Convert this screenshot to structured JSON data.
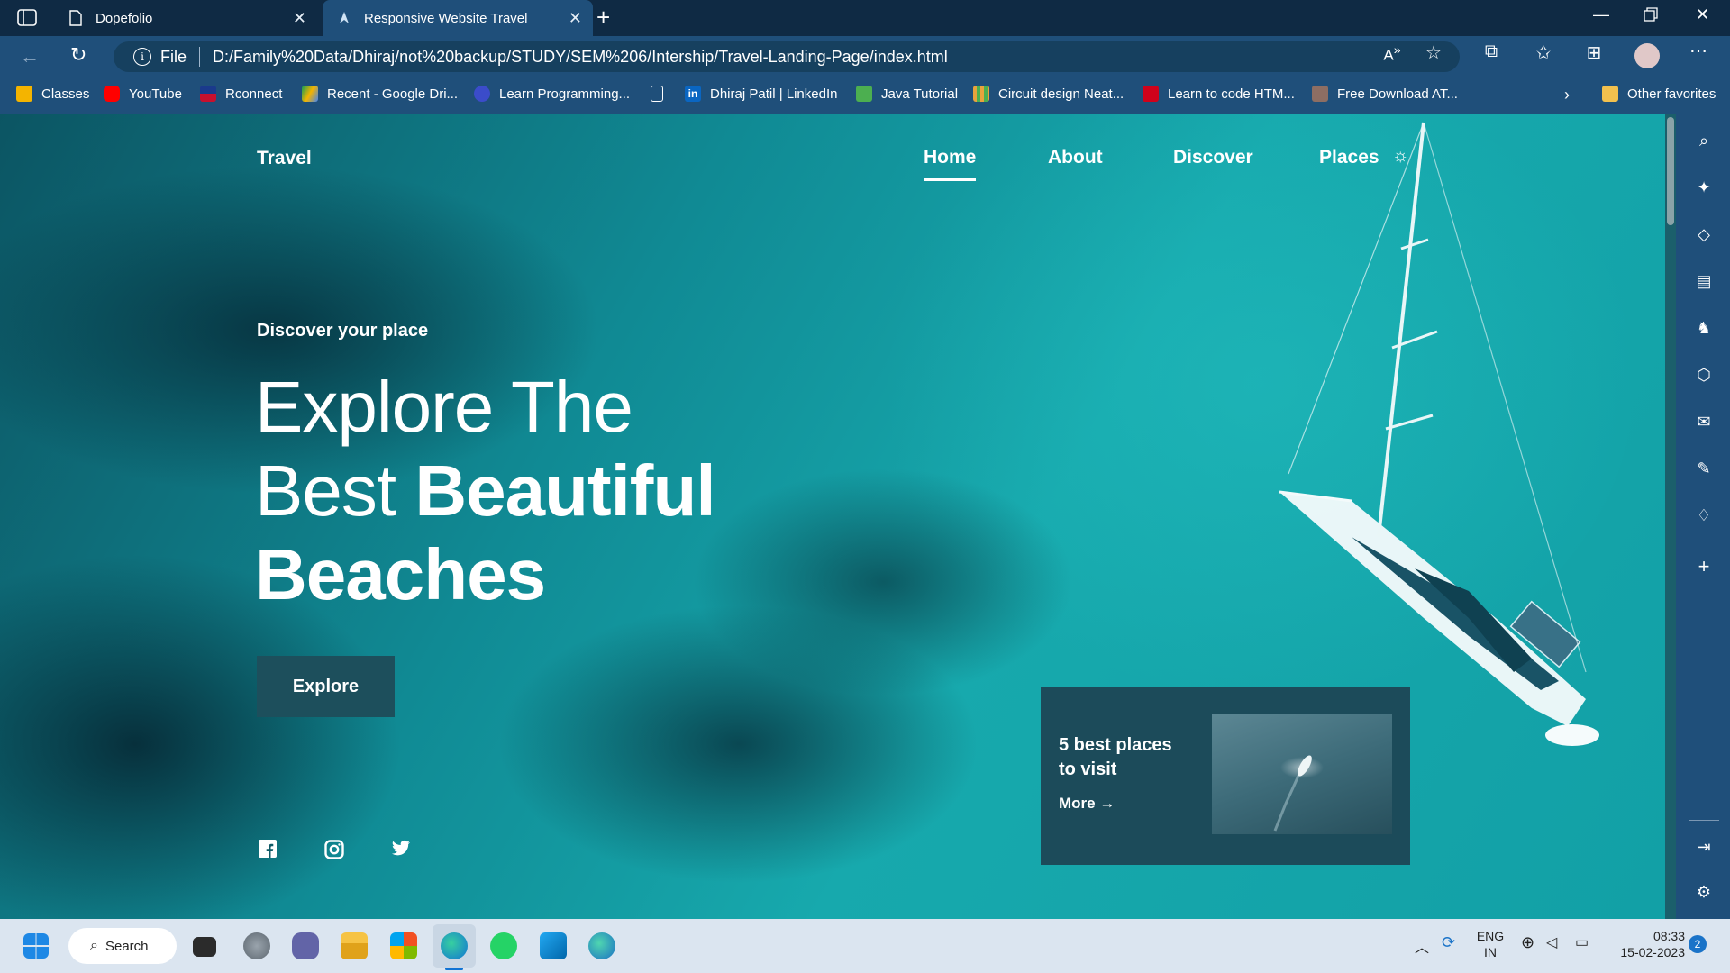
{
  "browser": {
    "tabs": [
      {
        "label": "Dopefolio",
        "icon": "page-icon"
      },
      {
        "label": "Responsive Website Travel",
        "icon": "site-icon"
      }
    ],
    "address": {
      "prefix": "File",
      "url": "D:/Family%20Data/Dhiraj/not%20backup/STUDY/SEM%206/Intership/Travel-Landing-Page/index.html"
    },
    "favorites": [
      {
        "label": "Classes",
        "color": "#f4b400"
      },
      {
        "label": "YouTube",
        "color": "#ff0000"
      },
      {
        "label": "Rconnect",
        "color": "#c8102e"
      },
      {
        "label": "Recent - Google Dri...",
        "color": "#0f9d58"
      },
      {
        "label": "Learn Programming...",
        "color": "#3b4cca"
      },
      {
        "label": "",
        "color": "#ffffff"
      },
      {
        "label": "Dhiraj Patil | LinkedIn",
        "color": "#0a66c2"
      },
      {
        "label": "Java Tutorial",
        "color": "#4caf50"
      },
      {
        "label": "Circuit design Neat...",
        "color": "#e8a33d"
      },
      {
        "label": "Learn to code HTM...",
        "color": "#d0021b"
      },
      {
        "label": "Free Download AT...",
        "color": "#8d6e63"
      }
    ],
    "other_favorites": "Other favorites"
  },
  "site": {
    "logo": "Travel",
    "nav": [
      "Home",
      "About",
      "Discover",
      "Places"
    ],
    "active_nav": "Home",
    "subtitle": "Discover your place",
    "heading": {
      "line1": "Explore The",
      "line2_light": "Best",
      "line2_bold": "Beautiful",
      "line3": "Beaches"
    },
    "cta": "Explore",
    "social": [
      "facebook-icon",
      "instagram-icon",
      "twitter-icon"
    ],
    "card": {
      "title": "5 best places to visit",
      "more": "More"
    }
  },
  "taskbar": {
    "search": "Search",
    "lang": "ENG",
    "region": "IN",
    "time": "08:33",
    "date": "15-02-2023",
    "notifications": "2"
  }
}
